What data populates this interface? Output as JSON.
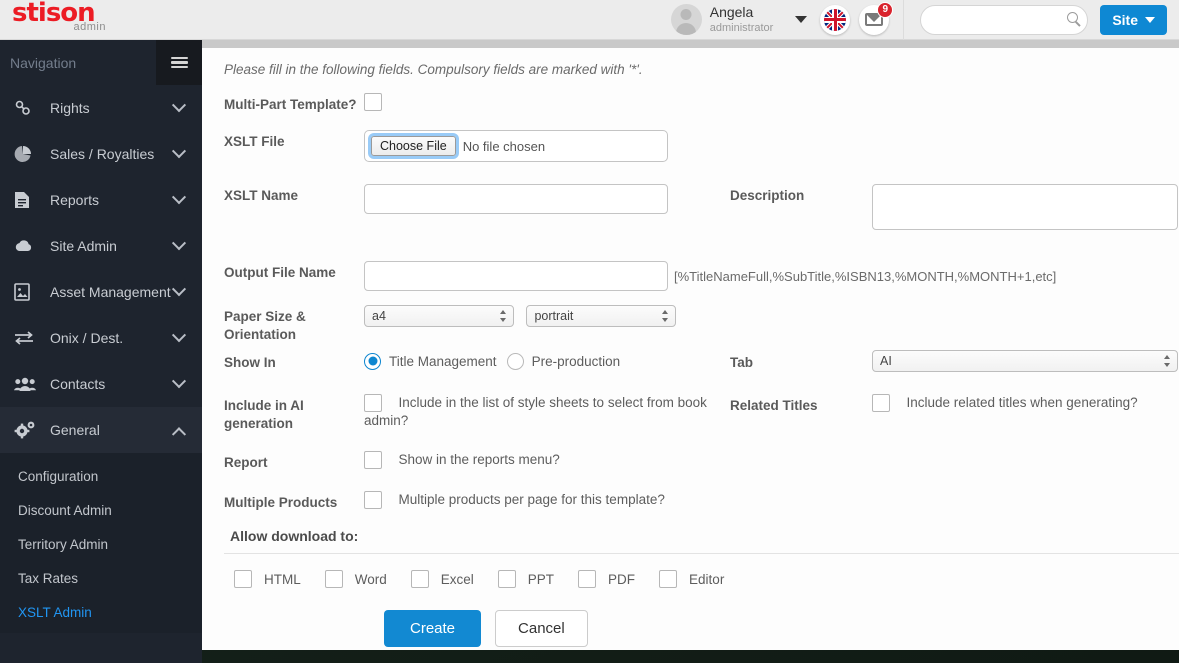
{
  "header": {
    "logo_main": "stison",
    "logo_sub": "admin",
    "user_name": "Angela",
    "user_role": "administrator",
    "user_caret_icon": "chevron-down-icon",
    "flag_icon": "uk-flag-icon",
    "messages_icon": "envelope-icon",
    "messages_badge": "9",
    "search_value": "",
    "search_placeholder": "",
    "search_icon": "search-icon",
    "site_button_label": "Site",
    "site_button_color": "#0e88d3"
  },
  "sidebar": {
    "title": "Navigation",
    "menu_icon": "hamburger-icon",
    "items": [
      {
        "label": "Rights",
        "icon": "chain-link-icon",
        "chevron": "chevron-down-icon"
      },
      {
        "label": "Sales / Royalties",
        "icon": "pie-chart-icon",
        "chevron": "chevron-down-icon"
      },
      {
        "label": "Reports",
        "icon": "document-icon",
        "chevron": "chevron-down-icon"
      },
      {
        "label": "Site Admin",
        "icon": "cloud-icon",
        "chevron": "chevron-down-icon"
      },
      {
        "label": "Asset Management",
        "icon": "image-file-icon",
        "chevron": "chevron-down-icon"
      },
      {
        "label": "Onix / Dest.",
        "icon": "exchange-arrows-icon",
        "chevron": "chevron-down-icon"
      },
      {
        "label": "Contacts",
        "icon": "users-icon",
        "chevron": "chevron-down-icon"
      },
      {
        "label": "General",
        "icon": "gears-icon",
        "chevron": "chevron-up-icon"
      }
    ],
    "sub_items": [
      {
        "label": "Configuration",
        "active": false
      },
      {
        "label": "Discount Admin",
        "active": false
      },
      {
        "label": "Territory Admin",
        "active": false
      },
      {
        "label": "Tax Rates",
        "active": false
      },
      {
        "label": "XSLT Admin",
        "active": true
      }
    ],
    "active_color": "#2196f3"
  },
  "form": {
    "intro": "Please fill in the following fields. Compulsory fields are marked with '*'.",
    "multipart_label": "Multi-Part Template?",
    "multipart_checked": false,
    "xslt_file_label": "XSLT File",
    "choose_file_button": "Choose File",
    "file_status": "No file chosen",
    "xslt_name_label": "XSLT Name",
    "xslt_name_value": "",
    "description_label": "Description",
    "description_value": "",
    "output_file_label": "Output File Name",
    "output_file_value": "",
    "output_file_hint": "[%TitleNameFull,%SubTitle,%ISBN13,%MONTH,%MONTH+1,etc]",
    "paper_label": "Paper Size & Orientation",
    "paper_size_value": "a4",
    "paper_orientation_value": "portrait",
    "show_in_label": "Show In",
    "show_in_option_1": "Title Management",
    "show_in_option_2": "Pre-production",
    "show_in_selected": "Title Management",
    "tab_label": "Tab",
    "tab_value": "AI",
    "include_ai_label": "Include in AI generation",
    "include_ai_text": "Include in the list of style sheets to select from book admin?",
    "include_ai_checked": false,
    "related_titles_label": "Related Titles",
    "related_titles_text": "Include related titles when generating?",
    "related_titles_checked": false,
    "report_label": "Report",
    "report_text": "Show in the reports menu?",
    "report_checked": false,
    "multiple_products_label": "Multiple Products",
    "multiple_products_text": "Multiple products per page for this template?",
    "multiple_products_checked": false,
    "allow_download_title": "Allow download to:",
    "download_options": [
      {
        "label": "HTML",
        "checked": false
      },
      {
        "label": "Word",
        "checked": false
      },
      {
        "label": "Excel",
        "checked": false
      },
      {
        "label": "PPT",
        "checked": false
      },
      {
        "label": "PDF",
        "checked": false
      },
      {
        "label": "Editor",
        "checked": false
      }
    ],
    "create_button": "Create",
    "cancel_button": "Cancel"
  }
}
